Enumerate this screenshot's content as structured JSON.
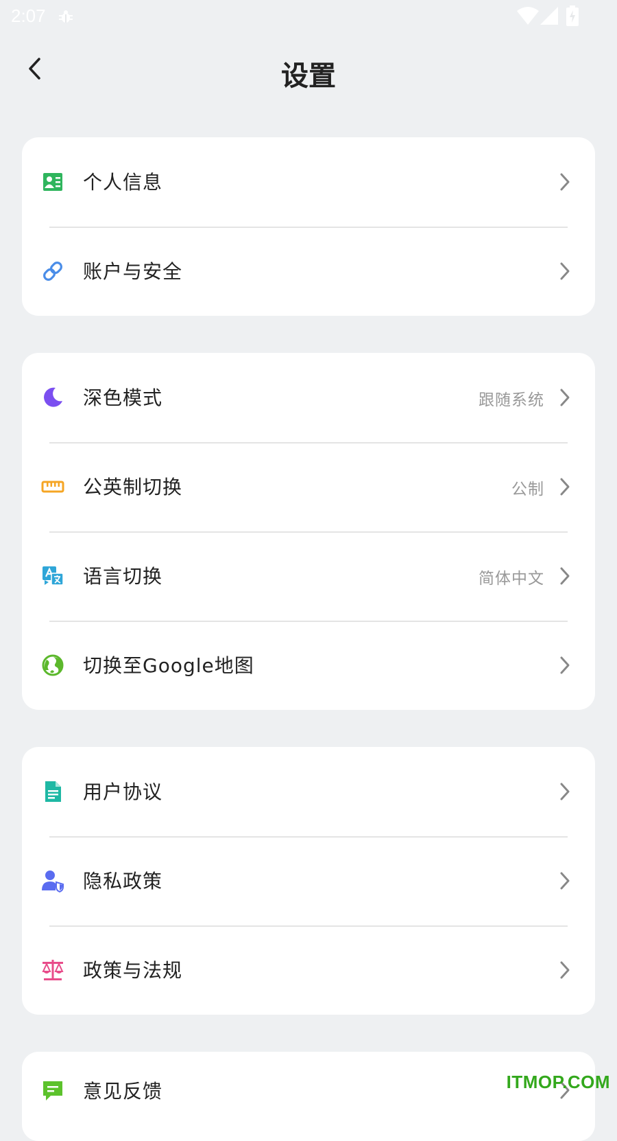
{
  "status_bar": {
    "time": "2:07",
    "icons": [
      "bug-icon",
      "wifi-icon",
      "cellular-signal-icon",
      "battery-charging-icon"
    ]
  },
  "header": {
    "back_icon": "chevron-left-icon",
    "title": "设置"
  },
  "groups": [
    {
      "items": [
        {
          "label": "个人信息",
          "value": "",
          "icon": "id-card-icon",
          "color": "#2fb55d"
        },
        {
          "label": "账户与安全",
          "value": "",
          "icon": "link-icon",
          "color": "#4a8de8"
        }
      ]
    },
    {
      "items": [
        {
          "label": "深色模式",
          "value": "跟随系统",
          "icon": "moon-icon",
          "color": "#7b4ff0"
        },
        {
          "label": "公英制切换",
          "value": "公制",
          "icon": "ruler-icon",
          "color": "#f5a524"
        },
        {
          "label": "语言切换",
          "value": "简体中文",
          "icon": "translate-icon",
          "color": "#2fa6d8"
        },
        {
          "label": "切换至Google地图",
          "value": "",
          "icon": "globe-icon",
          "color": "#5cb82c"
        }
      ]
    },
    {
      "items": [
        {
          "label": "用户协议",
          "value": "",
          "icon": "document-icon",
          "color": "#1eb8a4"
        },
        {
          "label": "隐私政策",
          "value": "",
          "icon": "user-shield-icon",
          "color": "#5a6cf0"
        },
        {
          "label": "政策与法规",
          "value": "",
          "icon": "scale-icon",
          "color": "#e84c8a"
        }
      ]
    },
    {
      "items": [
        {
          "label": "意见反馈",
          "value": "",
          "icon": "feedback-icon",
          "color": "#5cc22c"
        }
      ]
    }
  ],
  "chevron_icon": "chevron-right-icon",
  "watermark": "ITMOP.COM"
}
